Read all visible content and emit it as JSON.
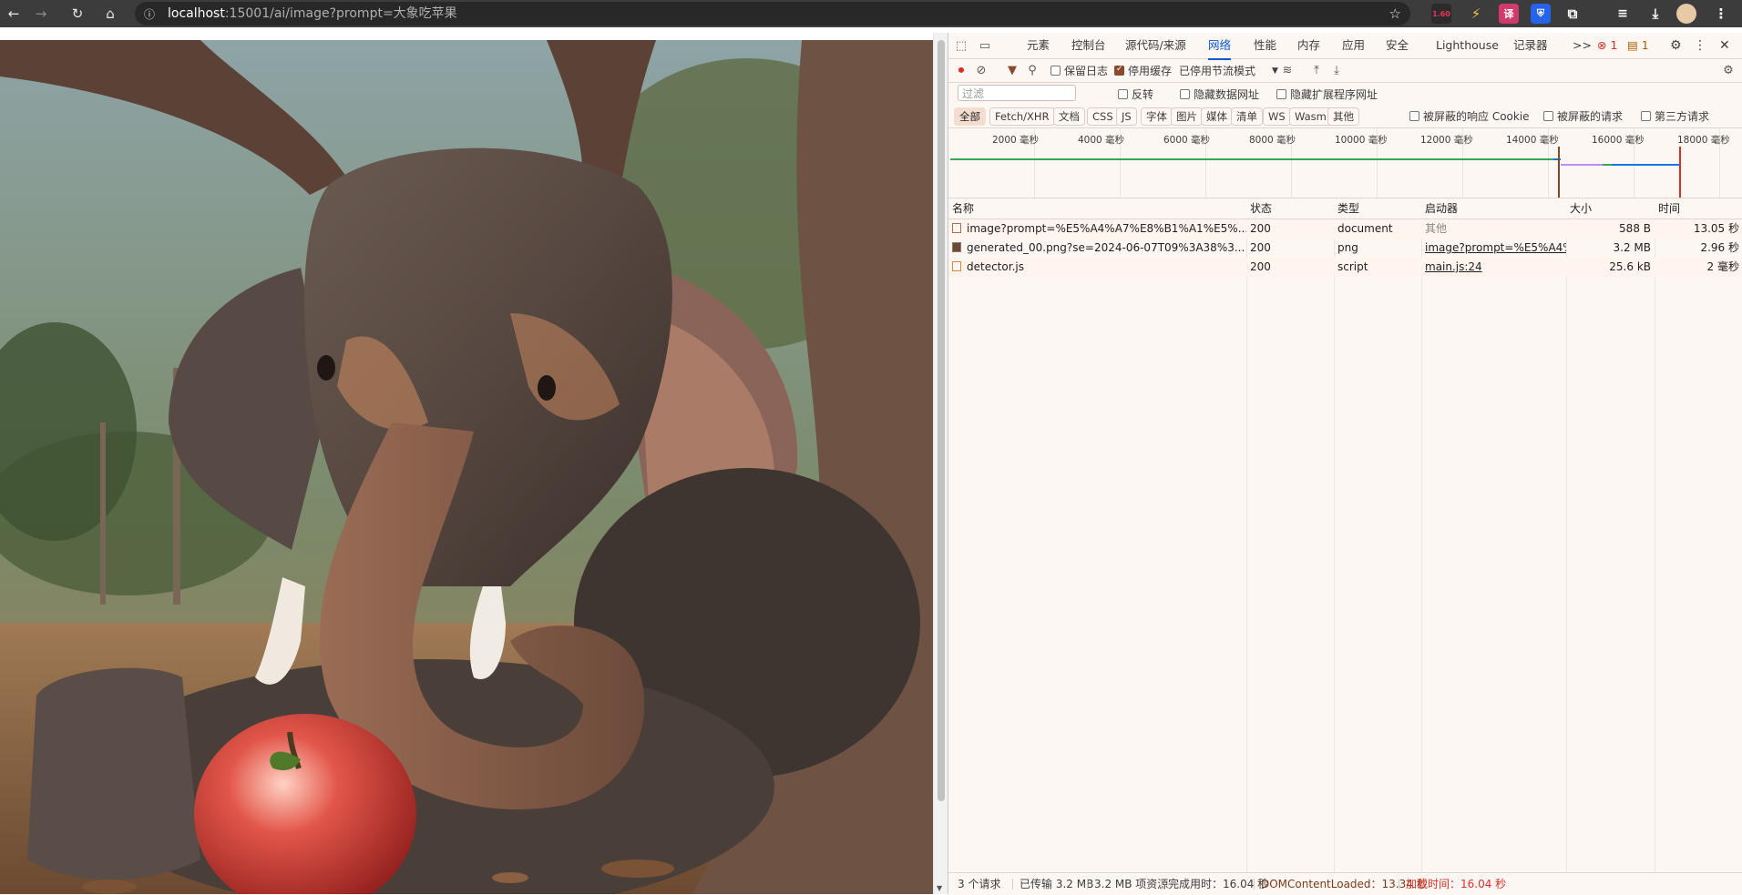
{
  "browser": {
    "url_host": "localhost",
    "url_path": ":15001/ai/image?prompt=大象吃苹果",
    "extensions": {
      "badge_value": "1.60"
    }
  },
  "devtools": {
    "tabs": [
      "元素",
      "控制台",
      "源代码/来源",
      "网络",
      "性能",
      "内存",
      "应用",
      "安全",
      "Lighthouse",
      "记录器"
    ],
    "active_tab": "网络",
    "more_tabs": ">>",
    "error_count": "1",
    "message_count": "1",
    "toolbar": {
      "preserve_log": "保留日志",
      "disable_cache": "停用缓存",
      "throttle": "已停用节流模式"
    },
    "filter": {
      "placeholder": "过滤",
      "invert": "反转",
      "hide_data_urls": "隐藏数据网址",
      "hide_ext_urls": "隐藏扩展程序网址"
    },
    "type_filters": [
      "全部",
      "Fetch/XHR",
      "文档",
      "CSS",
      "JS",
      "字体",
      "图片",
      "媒体",
      "清单",
      "WS",
      "Wasm",
      "其他"
    ],
    "blocked_cookies": "被屏蔽的响应 Cookie",
    "blocked_requests": "被屏蔽的请求",
    "third_party": "第三方请求",
    "overview_ticks": [
      "2000 毫秒",
      "4000 毫秒",
      "6000 毫秒",
      "8000 毫秒",
      "10000 毫秒",
      "12000 毫秒",
      "14000 毫秒",
      "16000 毫秒",
      "18000 毫秒"
    ],
    "columns": [
      "名称",
      "状态",
      "类型",
      "启动器",
      "大小",
      "时间"
    ],
    "rows": [
      {
        "name": "image?prompt=%E5%A4%A7%E8%B1%A1%E5%...",
        "status": "200",
        "type": "document",
        "initiator": "其他",
        "size": "588 B",
        "time": "13.05 秒"
      },
      {
        "name": "generated_00.png?se=2024-06-07T09%3A38%3...",
        "status": "200",
        "type": "png",
        "initiator": "image?prompt=%E5%A4%",
        "size": "3.2 MB",
        "time": "2.96 秒"
      },
      {
        "name": "detector.js",
        "status": "200",
        "type": "script",
        "initiator": "main.js:24",
        "size": "25.6 kB",
        "time": "2 毫秒"
      }
    ],
    "status_bar": {
      "requests": "3 个请求",
      "transferred": "已传输 3.2 MB",
      "resources": "3.2 MB 项资源",
      "finish": "完成用时：16.04 秒",
      "dcl": "DOMContentLoaded：13.34 秒",
      "load": "加载时间：16.04 秒"
    }
  },
  "colors": {
    "accent_blue": "#0b57d0",
    "load_red": "#d93025",
    "dcl_blue": "#1a73e8"
  }
}
